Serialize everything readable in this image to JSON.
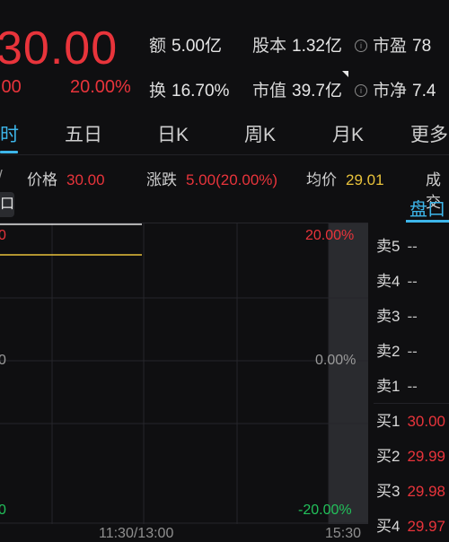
{
  "quote": {
    "price": "30.00",
    "change_abs_partial": ".00",
    "change_pct": "20.00%"
  },
  "stats": {
    "amount_label": "额",
    "amount_value": "5.00亿",
    "share_capital_label": "股本",
    "share_capital_value": "1.32亿",
    "pe_label": "市盈",
    "pe_value": "78",
    "turnover_label": "换",
    "turnover_value": "16.70%",
    "market_cap_label": "市值",
    "market_cap_value": "39.7亿",
    "pb_label": "市净",
    "pb_value": "7.4",
    "info_icon_glyph": "i"
  },
  "tabs": {
    "minute_partial": "时",
    "five_day": "五日",
    "daily_k": "日K",
    "weekly_k": "周K",
    "monthly_k": "月K",
    "more_partial": "更多"
  },
  "info_bar": {
    "partial_left": "/",
    "price_label": "价格",
    "price_value": "30.00",
    "change_label": "涨跌",
    "change_value": "5.00(20.00%)",
    "avg_label": "均价",
    "avg_value": "29.01",
    "volume_partial": "成交"
  },
  "chart": {
    "left_tag": "口",
    "left_top_label": "0",
    "left_mid_label": "0",
    "left_bottom_label": "0",
    "right_top_label": "20.00%",
    "right_mid_label": "0.00%",
    "right_bottom_label": "-20.00%",
    "time_mid": "11:30/13:00",
    "time_end": "15:30",
    "price_line_color": "#e9c23b",
    "limit_line_color": "#e6e6e6"
  },
  "order_book": {
    "tab_label": "盘口",
    "rows": [
      {
        "name": "卖5",
        "price": "--"
      },
      {
        "name": "卖4",
        "price": "--"
      },
      {
        "name": "卖3",
        "price": "--"
      },
      {
        "name": "卖2",
        "price": "--"
      },
      {
        "name": "卖1",
        "price": "--"
      },
      {
        "name": "买1",
        "price": "30.00"
      },
      {
        "name": "买2",
        "price": "29.99"
      },
      {
        "name": "买3",
        "price": "29.98"
      },
      {
        "name": "买4",
        "price": "29.97"
      }
    ]
  }
}
